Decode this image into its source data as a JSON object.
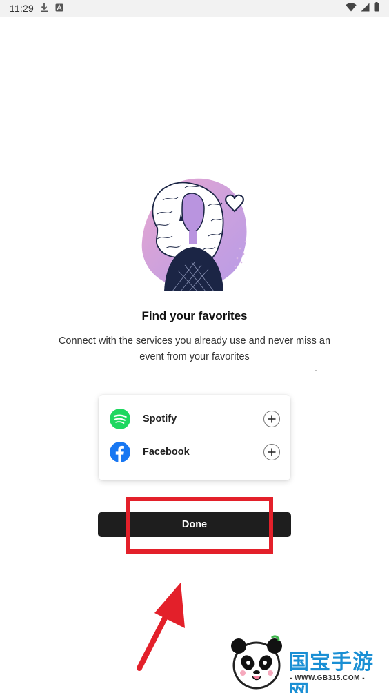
{
  "status_bar": {
    "time": "11:29",
    "icons": [
      "download-icon",
      "a-notification-icon",
      "wifi-icon",
      "signal-icon",
      "battery-icon"
    ]
  },
  "onboarding": {
    "title": "Find your favorites",
    "subtitle": "Connect with the services you already use and never miss an event from your favorites",
    "illustration_icon": "woman-with-heart-illustration"
  },
  "services": [
    {
      "label": "Spotify",
      "icon": "spotify-icon",
      "color": "#1ed760"
    },
    {
      "label": "Facebook",
      "icon": "facebook-icon",
      "color": "#1877f2"
    }
  ],
  "done_label": "Done",
  "annotation": {
    "highlight_color": "#e3202a",
    "arrow_icon": "red-arrow-icon"
  },
  "watermark": {
    "title": "国宝手游网",
    "url": "- WWW.GB315.COM -",
    "icon": "panda-logo-icon"
  }
}
